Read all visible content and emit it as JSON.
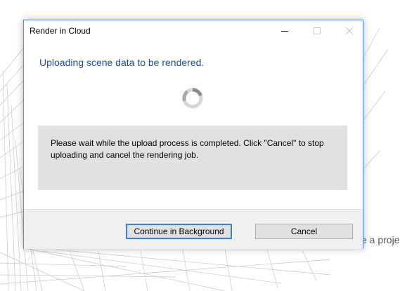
{
  "background": {
    "partial_text": "e a proje"
  },
  "dialog": {
    "title": "Render in Cloud",
    "heading": "Uploading scene data to be rendered.",
    "message": "Please wait while the upload process is completed. Click \"Cancel\" to stop uploading and cancel the rendering job.",
    "buttons": {
      "continue_label": "Continue in Background",
      "cancel_label": "Cancel"
    },
    "window_controls": {
      "minimize_icon": "minimize-icon",
      "maximize_icon": "maximize-icon",
      "close_icon": "close-icon"
    },
    "spinner_icon": "loading-spinner-icon"
  },
  "colors": {
    "accent_border": "#4a8ad8",
    "heading_text": "#1d4f91",
    "panel_bg": "#e1e1e1",
    "footer_bg": "#f0f0f0",
    "focused_button_border": "#3c7fd9"
  }
}
